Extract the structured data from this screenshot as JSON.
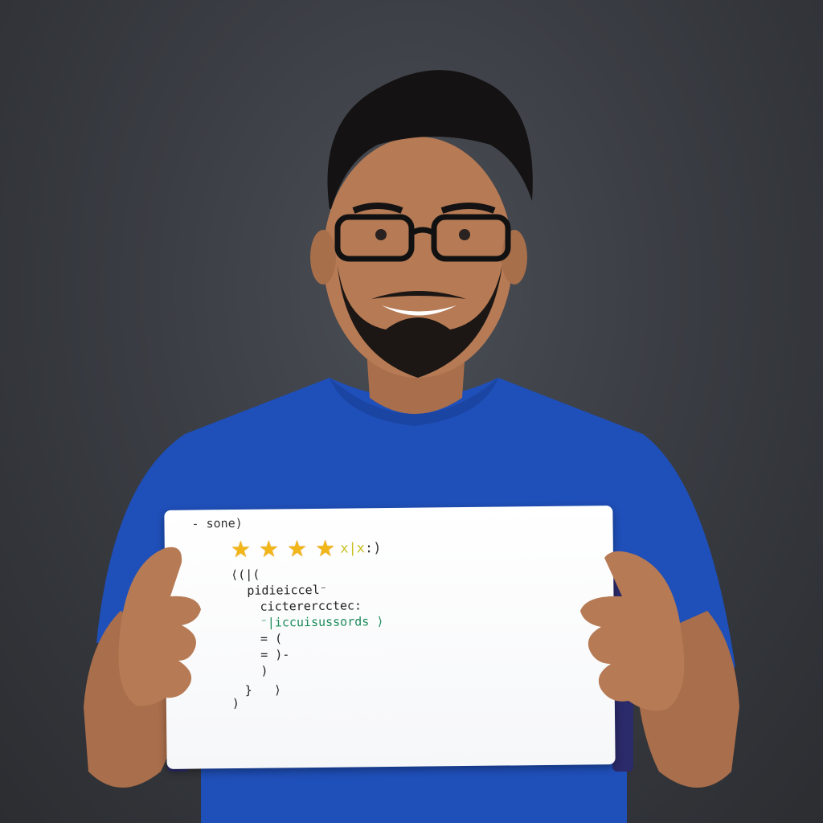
{
  "photo": {
    "subject": "person-holding-sign",
    "colors": {
      "background": "#3a3d43",
      "shirt": "#1f4fb8",
      "skin": "#b67a55",
      "hair": "#141212",
      "sign": "#ffffff"
    }
  },
  "sign": {
    "title": "- sone)",
    "rating": {
      "stars_filled": 4,
      "tail_x": "x|x",
      "tail_end": ":)"
    },
    "code_lines": [
      {
        "text": "⟨(|(",
        "color": "dark"
      },
      {
        "text": "pidieiccel⁻",
        "color": "dark"
      },
      {
        "text": "cicterercctec:",
        "color": "dark"
      },
      {
        "text": "⁻|iccuisussords ⟩",
        "color": "green"
      },
      {
        "text": "= (",
        "color": "dark"
      },
      {
        "text": "= )-",
        "color": "dark"
      },
      {
        "text": ")",
        "color": "dark"
      },
      {
        "text": "}   ⟩",
        "color": "dark"
      },
      {
        "text": ")",
        "color": "dark"
      }
    ]
  }
}
